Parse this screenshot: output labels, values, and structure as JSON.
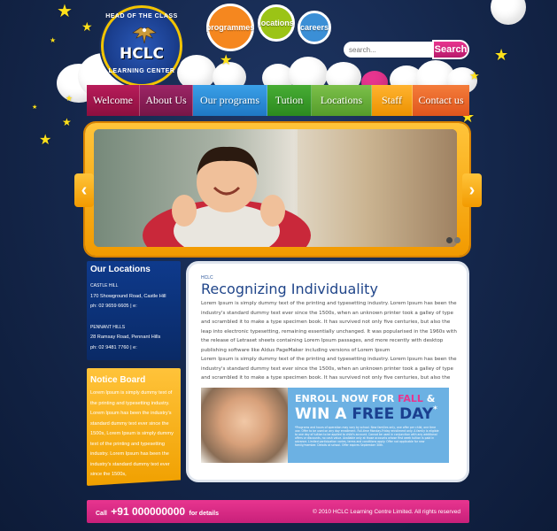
{
  "logo": {
    "ring_top": "HEAD OF THE CLASS",
    "name": "HCLC",
    "ring_bottom": "LEARNING CENTER"
  },
  "bubbles": [
    {
      "label": "programmes",
      "color": "#f5871f"
    },
    {
      "label": "locations",
      "color": "#9bc416"
    },
    {
      "label": "careers",
      "color": "#3b8fd6"
    }
  ],
  "search": {
    "placeholder": "search...",
    "button_label": "Search"
  },
  "nav": [
    {
      "label": "Welcome",
      "color": "#a3154d"
    },
    {
      "label": "About Us",
      "color": "#8c1d56"
    },
    {
      "label": "Our programs",
      "color": "#2f8fd8"
    },
    {
      "label": "Tution",
      "color": "#3a9a2a"
    },
    {
      "label": "Locations",
      "color": "#6bb03a"
    },
    {
      "label": "Staff",
      "color": "#f4a21b"
    },
    {
      "label": "Contact us",
      "color": "#ef6a2a"
    }
  ],
  "slider": {
    "prev_icon": "chevron-left-icon",
    "next_icon": "chevron-right-icon"
  },
  "locations": {
    "title": "Our Locations",
    "items": [
      {
        "name": "CASTLE HILL",
        "address": "170 Showground Road, Castle Hill",
        "phone": "ph: 02 9659 6605 | e:"
      },
      {
        "name": "PENNANT HILLS",
        "address": "28 Ramsay Road, Pennant Hills",
        "phone": "ph: 02 9481 7760 | e:"
      }
    ]
  },
  "notice": {
    "title": "Notice Board",
    "text": "Lorem Ipsum is simply dummy text of the printing and typesetting industry. Lorem Ipsum has been the industry's standard dummy text ever since the 1500s, Lorem Ipsum is simply dummy text of the printing and typesetting industry. Lorem Ipsum has been the industry's standard dummy text ever since the 1500s,"
  },
  "content": {
    "breadcrumb": "HCLC",
    "title": "Recognizing Individuality",
    "para1": "Lorem Ipsum is simply dummy text of the printing and typesetting industry. Lorem Ipsum has been the industry's standard dummy text ever since the 1500s, when an unknown printer took a galley of type and scrambled it to make a type specimen book. It has survived not only five centuries, but also the leap into electronic typesetting, remaining essentially unchanged. It was popularised in the 1960s with the release of Letraset sheets containing Lorem Ipsum passages, and more recently with desktop publishing software like Aldus PageMaker including versions of Lorem Ipsum",
    "para2": "Lorem Ipsum is simply dummy text of the printing and typesetting industry. Lorem Ipsum has been the industry's standard dummy text ever since the 1500s, when an unknown printer took a galley of type and scrambled it to make a type specimen book. It has survived not only five centuries, but also the",
    "banner": {
      "line1": "ENROLL NOW FOR",
      "fall": "FALL",
      "amp": "&",
      "line2a": "WIN A",
      "line2b": "FREE DAY",
      "asterisk": "*",
      "fine_print": "*Programs and hours of operation may vary by school. New families only, one offer per child, one time use. Offer to be used on any day enrollment. Full-time Monday-Friday enrollment only. A family is eligible to one day of tuition to be applied to child's account. Cannot be used in conjunction with any additional offers or discounts, no cash value. Available only at those accounts whose first week tuition is paid in advance. Limited participation varies, terms and conditions apply. Offer not applicable for new family/member. Details at school. Offer expires September 30th."
    }
  },
  "footer": {
    "call_prefix": "Call",
    "phone": "+91 000000000",
    "call_suffix": "for details",
    "copyright": "2010 HCLC Learning Centre Limited. All rights reserved"
  }
}
